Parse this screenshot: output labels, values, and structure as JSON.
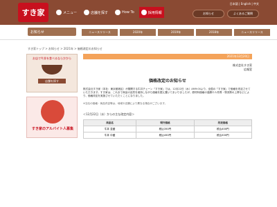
{
  "header": {
    "logo_text": "すき家",
    "nav": [
      "メニュー",
      "店舗を探す",
      "How To",
      "採用情報"
    ],
    "langs": "日本語 | English | 中文",
    "buttons": [
      "お知らせ",
      "よくあるご質問"
    ]
  },
  "subnav": {
    "logo_text": "お知らせ",
    "tabs": [
      "ニュースリリース",
      "2020年",
      "2019年",
      "2018年",
      "ニュースリリース"
    ]
  },
  "breadcrumb": "すき家トップ > お知らせ > 2021年 > 価格改定のお知らせ",
  "sidebar": {
    "card1_title": "お店で牛丼を食べるならかから",
    "card1_btn": "店舗を探す",
    "card2_title": "すき家のアルバイト人募集"
  },
  "main": {
    "date": "2021年12月20日",
    "company": [
      "株式会社すき家",
      "広報室"
    ],
    "title": "価格改定のお知らせ",
    "body": "株式会社すき家（本社：東京都港区）が展開する牛丼チェーン「すき家」では、12月22日（水）AM9:00より、全国の「すき家」で価格を改定させていただきます。すき家は、これまで商品の品質を維持しながら価格を据え置いてまいりましたが、原材料価格の高騰や人件費・物流費の上昇などにより、価格改定を実施させていただくことになりました。",
    "note": "※当社の価格・商品内容等は、地域や店舗により異なる場合がございます。",
    "list_title": "＜12月22日（水）からの主な改定内容＞",
    "table_headers": [
      "商品名",
      "現行価格",
      "改定価格"
    ],
    "table_rows": [
      [
        "牛丼 並盛",
        "税込350円",
        "税込400円"
      ],
      [
        "牛丼 中盛",
        "税込450円",
        "税込500円"
      ]
    ]
  }
}
